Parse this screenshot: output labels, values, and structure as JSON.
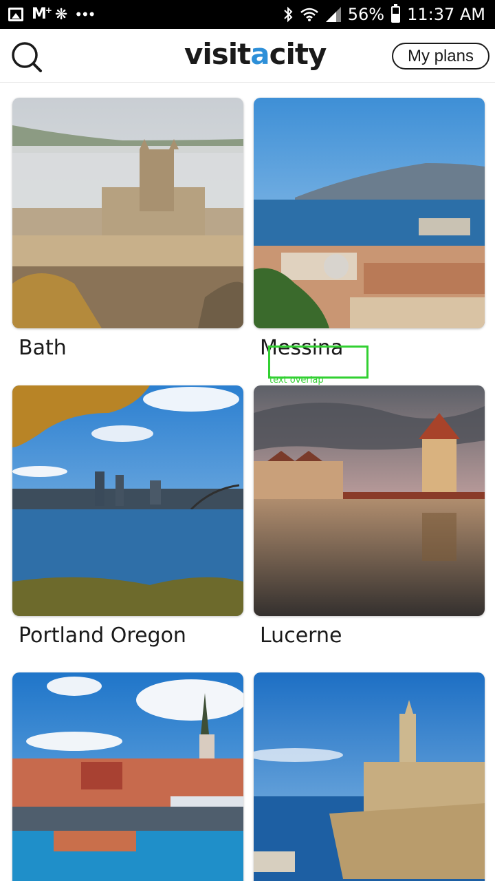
{
  "status_bar": {
    "battery": "56%",
    "time": "11:37 AM"
  },
  "header": {
    "logo": "visitacity",
    "logo_parts": [
      "visit",
      "a",
      "city"
    ],
    "my_plans_label": "My plans"
  },
  "cities": [
    {
      "name": "Bath"
    },
    {
      "name": "Messina"
    },
    {
      "name": "Portland Oregon"
    },
    {
      "name": "Lucerne"
    },
    {
      "name": "",
      "note": "unlabeled (cut off)"
    },
    {
      "name": ""
    }
  ],
  "annotation": {
    "label": "text overlap"
  },
  "colors": {
    "accent": "#2d8fd8",
    "text": "#1a1a1a",
    "annotation": "#32d032"
  }
}
